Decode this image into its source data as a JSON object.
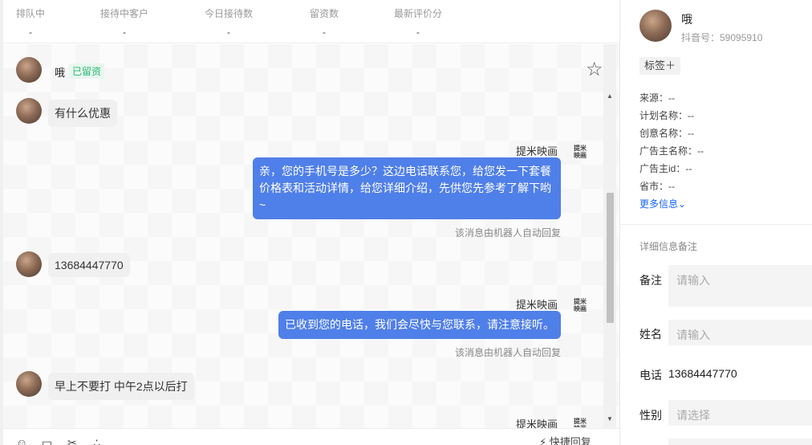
{
  "stats": [
    {
      "label": "排队中",
      "value": "-"
    },
    {
      "label": "接待中客户",
      "value": "-"
    },
    {
      "label": "今日接待数",
      "value": "-"
    },
    {
      "label": "留资数",
      "value": "-"
    },
    {
      "label": "最新评价分",
      "value": "-"
    }
  ],
  "chat_header": {
    "name": "哦",
    "tag": "已留资",
    "star_icon": "star-outline-icon"
  },
  "messages": [
    {
      "side": "customer",
      "text": "有什么优惠"
    },
    {
      "side": "agent",
      "sender": "提米映画",
      "text": "亲，您的手机号是多少？这边电话联系您，给您发一下套餐价格表和活动详情，给您详细介绍，先供您先参考了解下哟~",
      "note": "该消息由机器人自动回复"
    },
    {
      "side": "customer",
      "text": "13684447770"
    },
    {
      "side": "agent",
      "sender": "提米映画",
      "text": "已收到您的电话，我们会尽快与您联系，请注意接听。",
      "note": "该消息由机器人自动回复"
    },
    {
      "side": "customer",
      "text": "早上不要打 中午2点以后打"
    },
    {
      "side": "agent",
      "sender": "提米映画"
    }
  ],
  "agent_logo_text": "提米映画",
  "toolbar": {
    "icons": [
      "emoji-icon",
      "folder-icon",
      "scissors-icon",
      "more-icon"
    ],
    "quick_reply": "快捷回复"
  },
  "profile": {
    "name": "哦",
    "douyin_id": "抖音号：59095910",
    "tag_button": "标签＋",
    "fields": [
      {
        "label": "来源：",
        "value": "--"
      },
      {
        "label": "计划名称：",
        "value": "--"
      },
      {
        "label": "创意名称：",
        "value": "--"
      },
      {
        "label": "广告主名称：",
        "value": "--"
      },
      {
        "label": "广告主id：",
        "value": "--"
      },
      {
        "label": "省市：",
        "value": "--"
      }
    ],
    "more_info": "更多信息⌄",
    "section_title": "详细信息备注",
    "form": {
      "remark_label": "备注",
      "remark_placeholder": "请输入",
      "name_label": "姓名",
      "name_placeholder": "请输入",
      "phone_label": "电话",
      "phone_value": "13684447770",
      "gender_label": "性别",
      "gender_placeholder": "请选择"
    }
  },
  "colors": {
    "agent_bubble": "#4f7fe8",
    "customer_bubble": "#f0f0f0",
    "retained_tag": "#2bb673",
    "link": "#1966ff"
  }
}
